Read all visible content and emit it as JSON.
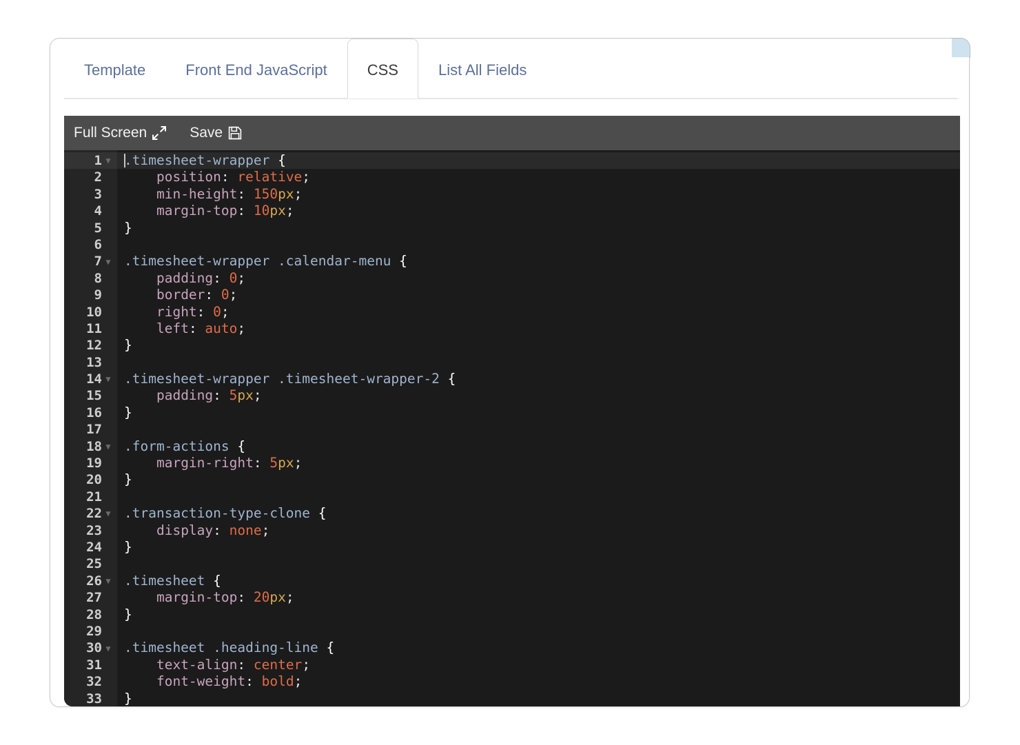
{
  "card": {
    "accent_color": "#cfe2ef"
  },
  "tabs": [
    {
      "label": "Template",
      "active": false
    },
    {
      "label": "Front End JavaScript",
      "active": false
    },
    {
      "label": "CSS",
      "active": true
    },
    {
      "label": "List All Fields",
      "active": false
    }
  ],
  "editor_toolbar": {
    "fullscreen_label": "Full Screen",
    "fullscreen_icon": "expand-arrows-icon",
    "save_label": "Save",
    "save_icon": "floppy-disk-icon"
  },
  "editor": {
    "language": "CSS",
    "theme_background": "#1b1b1b",
    "gutter_background": "#252525",
    "active_line": 1,
    "first_visible_line": 1,
    "last_visible_line": 33,
    "lines": [
      {
        "n": 1,
        "fold": true,
        "text": ".timesheet-wrapper {"
      },
      {
        "n": 2,
        "fold": false,
        "text": "    position: relative;"
      },
      {
        "n": 3,
        "fold": false,
        "text": "    min-height: 150px;"
      },
      {
        "n": 4,
        "fold": false,
        "text": "    margin-top: 10px;"
      },
      {
        "n": 5,
        "fold": false,
        "text": "}"
      },
      {
        "n": 6,
        "fold": false,
        "text": ""
      },
      {
        "n": 7,
        "fold": true,
        "text": ".timesheet-wrapper .calendar-menu {"
      },
      {
        "n": 8,
        "fold": false,
        "text": "    padding: 0;"
      },
      {
        "n": 9,
        "fold": false,
        "text": "    border: 0;"
      },
      {
        "n": 10,
        "fold": false,
        "text": "    right: 0;"
      },
      {
        "n": 11,
        "fold": false,
        "text": "    left: auto;"
      },
      {
        "n": 12,
        "fold": false,
        "text": "}"
      },
      {
        "n": 13,
        "fold": false,
        "text": ""
      },
      {
        "n": 14,
        "fold": true,
        "text": ".timesheet-wrapper .timesheet-wrapper-2 {"
      },
      {
        "n": 15,
        "fold": false,
        "text": "    padding: 5px;"
      },
      {
        "n": 16,
        "fold": false,
        "text": "}"
      },
      {
        "n": 17,
        "fold": false,
        "text": ""
      },
      {
        "n": 18,
        "fold": true,
        "text": ".form-actions {"
      },
      {
        "n": 19,
        "fold": false,
        "text": "    margin-right: 5px;"
      },
      {
        "n": 20,
        "fold": false,
        "text": "}"
      },
      {
        "n": 21,
        "fold": false,
        "text": ""
      },
      {
        "n": 22,
        "fold": true,
        "text": ".transaction-type-clone {"
      },
      {
        "n": 23,
        "fold": false,
        "text": "    display: none;"
      },
      {
        "n": 24,
        "fold": false,
        "text": "}"
      },
      {
        "n": 25,
        "fold": false,
        "text": ""
      },
      {
        "n": 26,
        "fold": true,
        "text": ".timesheet {"
      },
      {
        "n": 27,
        "fold": false,
        "text": "    margin-top: 20px;"
      },
      {
        "n": 28,
        "fold": false,
        "text": "}"
      },
      {
        "n": 29,
        "fold": false,
        "text": ""
      },
      {
        "n": 30,
        "fold": true,
        "text": ".timesheet .heading-line {"
      },
      {
        "n": 31,
        "fold": false,
        "text": "    text-align: center;"
      },
      {
        "n": 32,
        "fold": false,
        "text": "    font-weight: bold;"
      },
      {
        "n": 33,
        "fold": false,
        "text": "}"
      }
    ]
  }
}
